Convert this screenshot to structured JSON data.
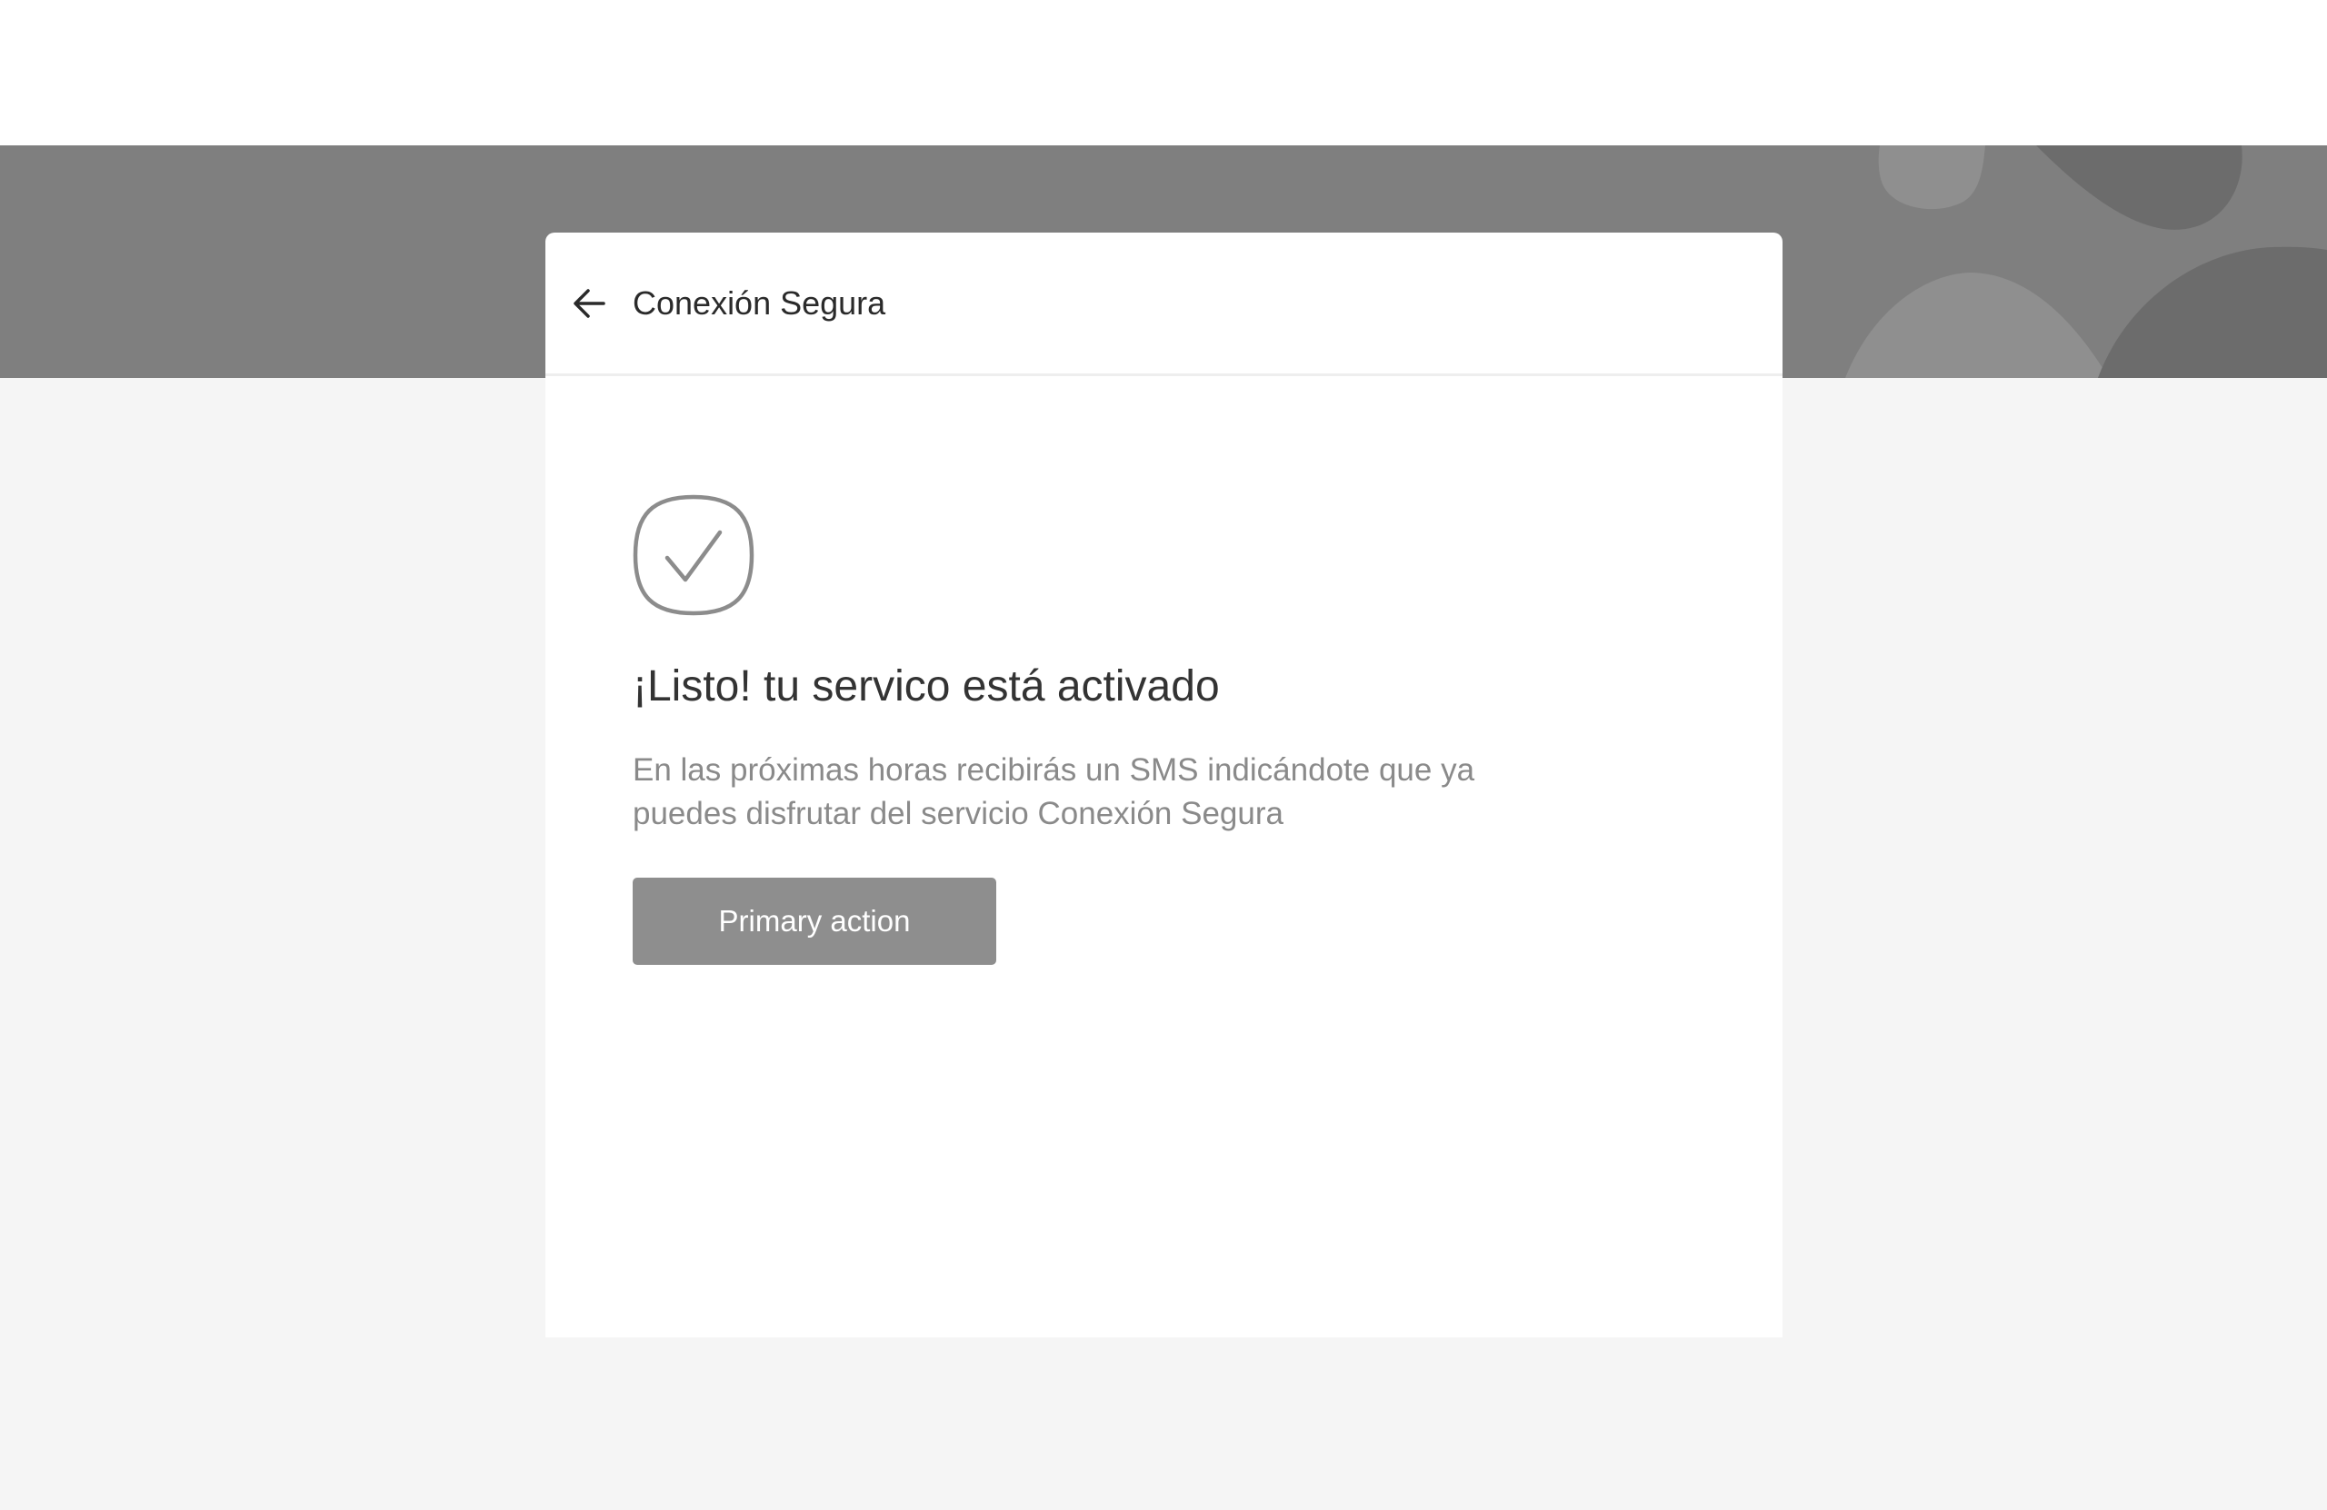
{
  "header": {
    "title": "Conexión Segura",
    "back_icon": "arrow-left-icon"
  },
  "success": {
    "icon": "checkmark-rounded-square-icon",
    "title": "¡Listo! tu servico está activado",
    "description": "En las próximas horas recibirás un SMS indicándote que ya puedes disfrutar del servicio Conexión Segura"
  },
  "actions": {
    "primary_label": "Primary action"
  },
  "colors": {
    "top_bar": "#ffffff",
    "hero_band": "#7f7f7f",
    "page_background": "#f5f5f5",
    "card": "#ffffff",
    "primary_button": "#8e8e8e",
    "icon_stroke": "#8c8c8c"
  }
}
